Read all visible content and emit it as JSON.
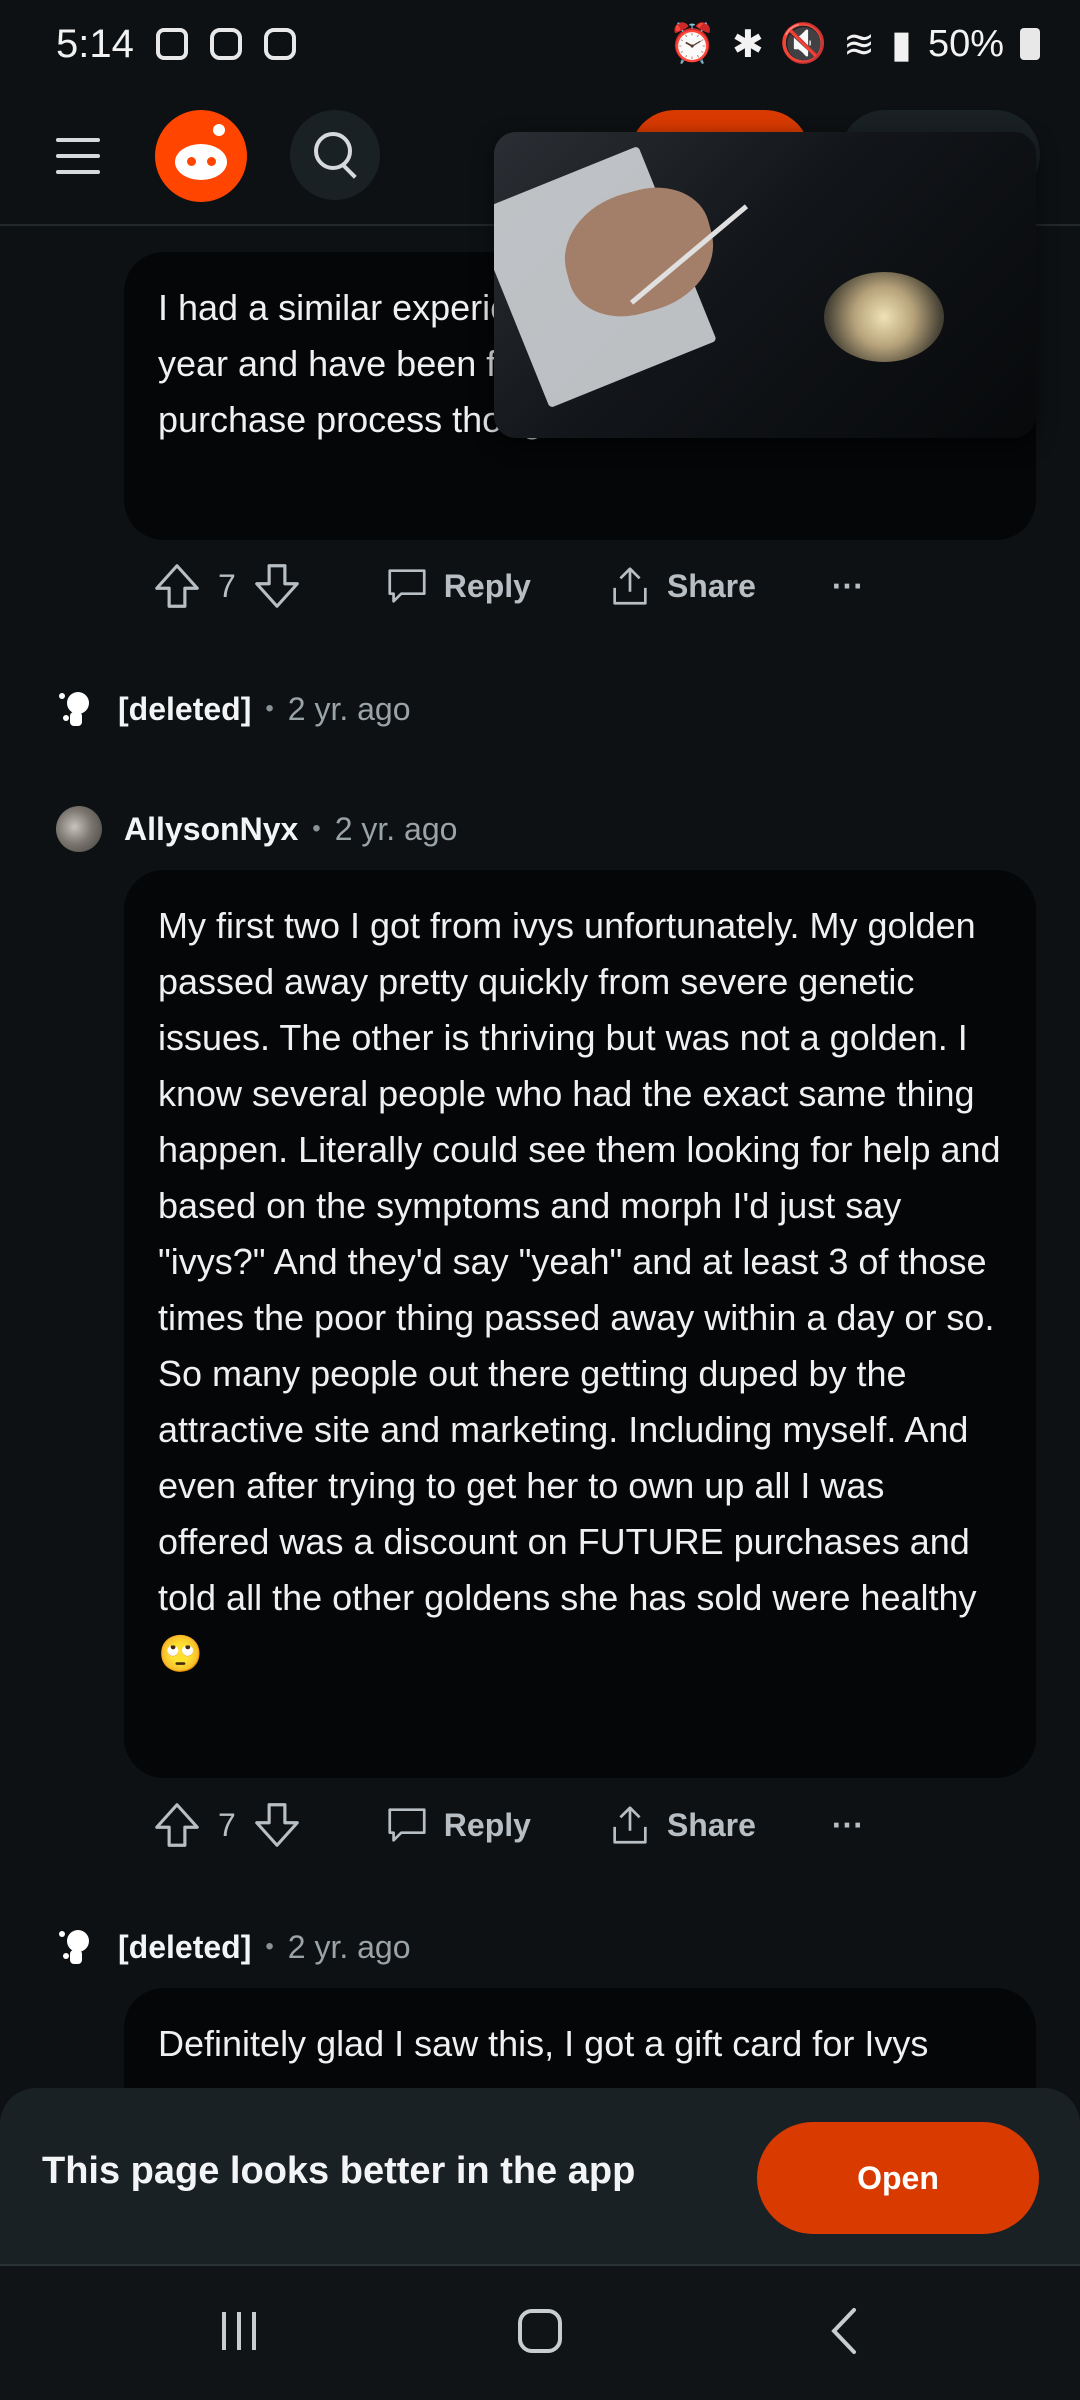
{
  "status_bar": {
    "time": "5:14",
    "battery": "50%"
  },
  "comments": [
    {
      "text": "I had a similar experience. I got mine from there last year and have been feeling guilty about the whole purchase process though",
      "votes": "7",
      "reply": "Reply",
      "share": "Share",
      "more": "···"
    },
    {
      "author": "[deleted]",
      "age": "2 yr. ago"
    },
    {
      "author": "AllysonNyx",
      "age": "2 yr. ago",
      "text": "My first two I got from ivys unfortunately. My golden passed away pretty quickly from severe genetic issues. The other is thriving but was not a golden. I know several people who had the exact same thing happen. Literally could see them looking for help and based on the symptoms and morph I'd just say \"ivys?\" And they'd say \"yeah\" and at least 3 of those times the poor thing passed away within a day or so. So many people out there getting duped by the attractive site and marketing. Including myself. And even after trying to get her to own up all I was offered was a discount on FUTURE purchases and told all the other goldens she has sold were healthy 🙄",
      "votes": "7",
      "reply": "Reply",
      "share": "Share",
      "more": "···"
    },
    {
      "author": "[deleted]",
      "age": "2 yr. ago",
      "text": "Definitely glad I saw this, I got a gift card for Ivys"
    }
  ],
  "banner": {
    "text": "This page looks better in the app",
    "open_label": "Open"
  },
  "colors": {
    "accent": "#d93a00",
    "brand": "#ff4500",
    "background": "#0e1113"
  }
}
